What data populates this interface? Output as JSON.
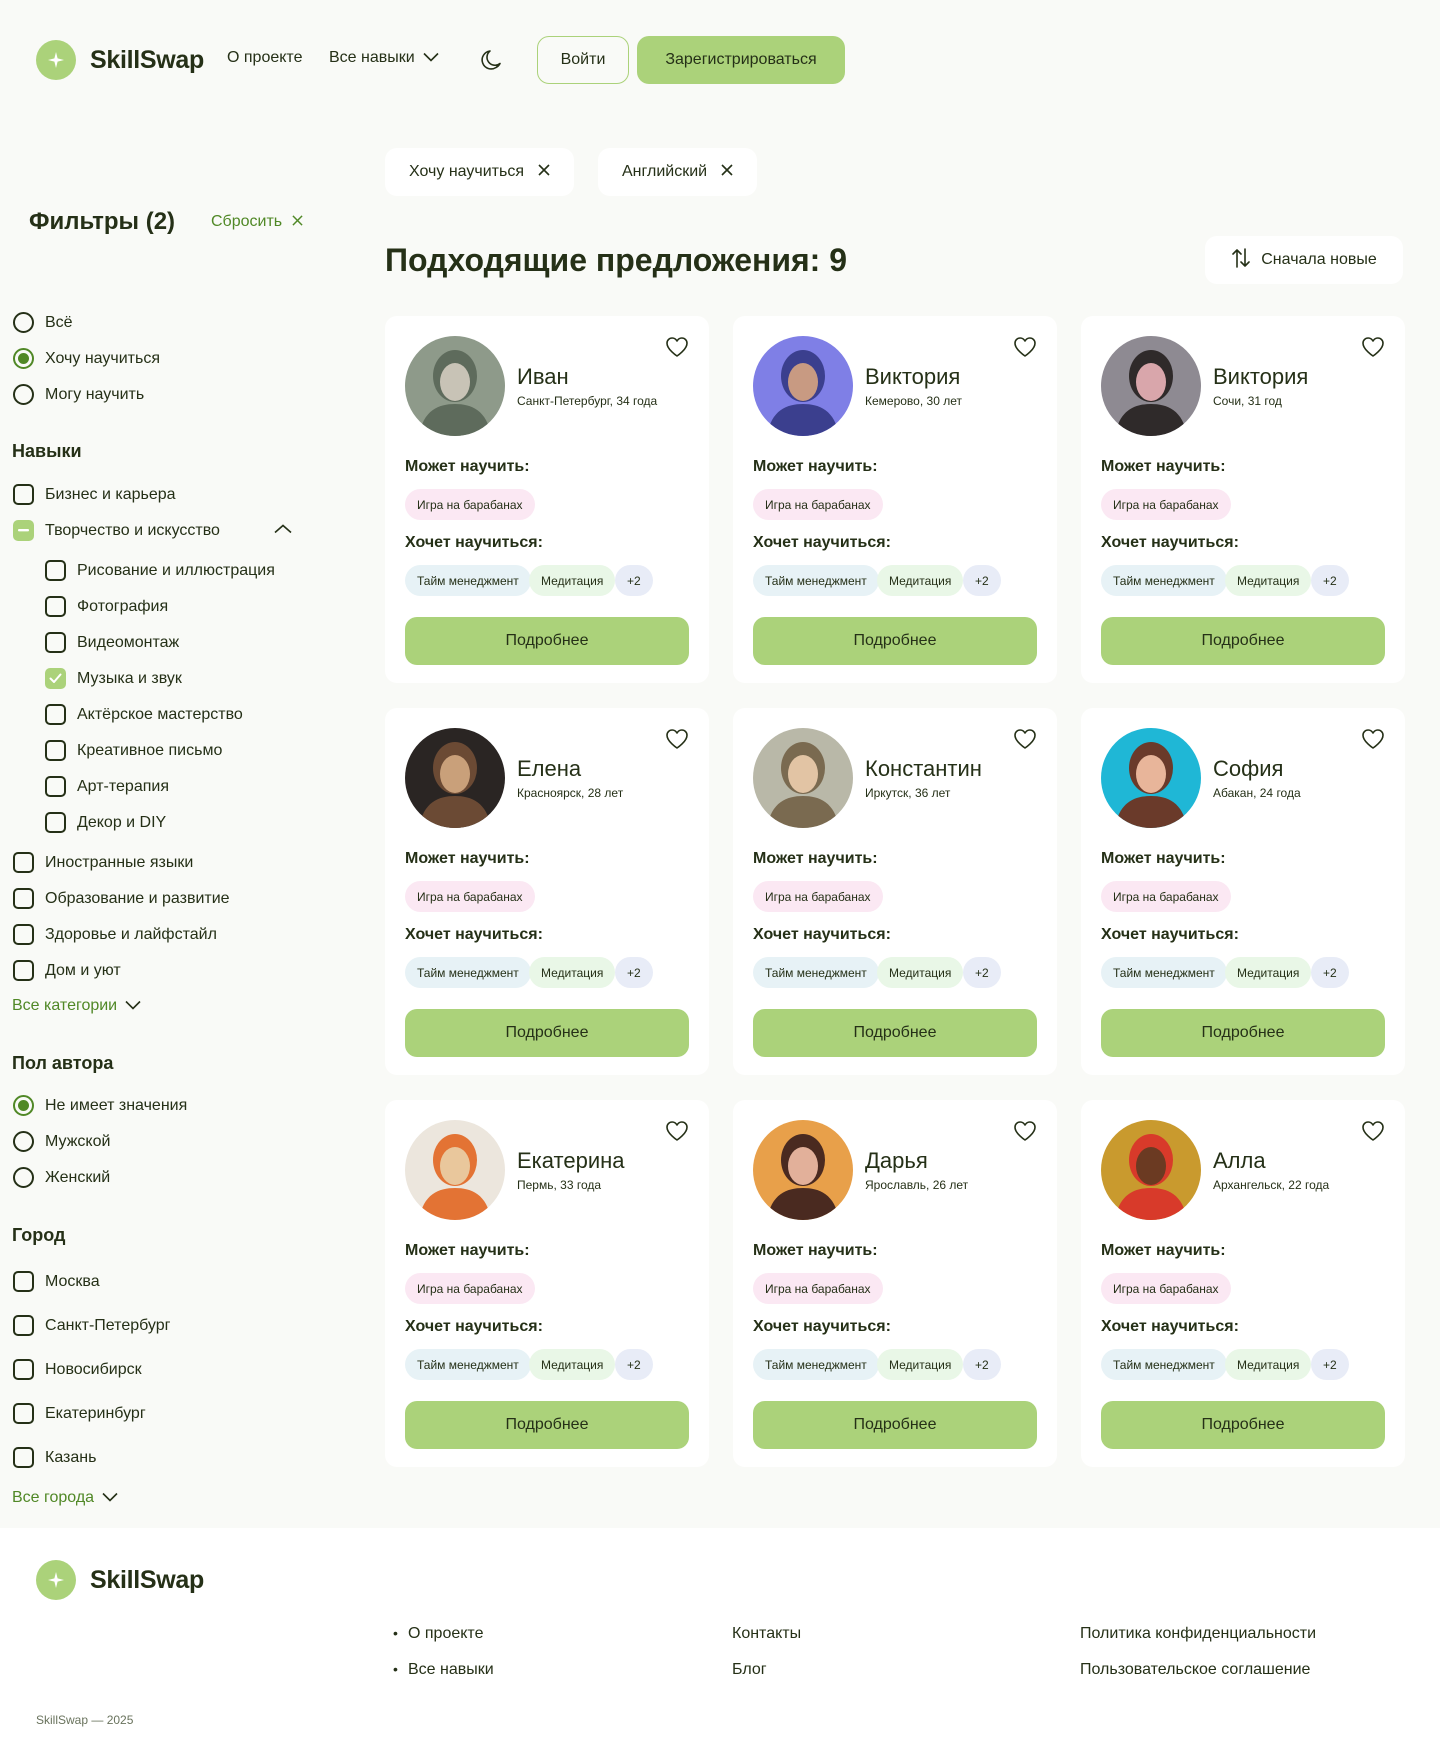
{
  "header": {
    "logo_text": "SkillSwap",
    "nav_about": "О проекте",
    "nav_skills": "Все навыки",
    "login": "Войти",
    "register": "Зарегистрироваться"
  },
  "active_filters": [
    "Хочу научиться",
    "Английский"
  ],
  "sidebar": {
    "title": "Фильтры (2)",
    "reset": "Сбросить",
    "mode_options": [
      {
        "label": "Всё",
        "checked": false
      },
      {
        "label": "Хочу научиться",
        "checked": true
      },
      {
        "label": "Могу научить",
        "checked": false
      }
    ],
    "skills_heading": "Навыки",
    "skills_top": [
      {
        "label": "Бизнес и карьера",
        "checked": false
      },
      {
        "label": "Творчество и искусство",
        "partial": true
      }
    ],
    "skills_sub": [
      {
        "label": "Рисование и иллюстрация",
        "checked": false
      },
      {
        "label": "Фотография",
        "checked": false
      },
      {
        "label": "Видеомонтаж",
        "checked": false
      },
      {
        "label": "Музыка и звук",
        "checked": true
      },
      {
        "label": "Актёрское мастерство",
        "checked": false
      },
      {
        "label": "Креативное письмо",
        "checked": false
      },
      {
        "label": "Арт-терапия",
        "checked": false
      },
      {
        "label": "Декор и DIY",
        "checked": false
      }
    ],
    "skills_bottom": [
      {
        "label": "Иностранные языки",
        "checked": false
      },
      {
        "label": "Образование и развитие",
        "checked": false
      },
      {
        "label": "Здоровье и лайфстайл",
        "checked": false
      },
      {
        "label": "Дом и уют",
        "checked": false
      }
    ],
    "all_categories": "Все категории",
    "gender_heading": "Пол автора",
    "gender_options": [
      {
        "label": "Не имеет значения",
        "checked": true
      },
      {
        "label": "Мужской",
        "checked": false
      },
      {
        "label": "Женский",
        "checked": false
      }
    ],
    "city_heading": "Город",
    "cities": [
      {
        "label": "Москва",
        "checked": false
      },
      {
        "label": "Санкт-Петербург",
        "checked": false
      },
      {
        "label": "Новосибирск",
        "checked": false
      },
      {
        "label": "Екатеринбург",
        "checked": false
      },
      {
        "label": "Казань",
        "checked": false
      }
    ],
    "all_cities": "Все города"
  },
  "results": {
    "title": "Подходящие предложения: 9",
    "sort": "Сначала новые"
  },
  "card_labels": {
    "can_teach": "Может научить:",
    "wants_learn": "Хочет научиться:",
    "details": "Подробнее"
  },
  "cards": [
    {
      "name": "Иван",
      "meta": "Санкт-Петербург, 34 года",
      "teach": "Игра на барабанах",
      "learn": [
        "Тайм менеджмент",
        "Медитация"
      ],
      "more": "+2",
      "avatar_colors": [
        "#8e9a8a",
        "#5e6b5c",
        "#c8c3b6"
      ]
    },
    {
      "name": "Виктория",
      "meta": "Кемерово, 30 лет",
      "teach": "Игра на барабанах",
      "learn": [
        "Тайм менеджмент",
        "Медитация"
      ],
      "more": "+2",
      "avatar_colors": [
        "#7f7fe6",
        "#3b3f8e",
        "#c89a82"
      ]
    },
    {
      "name": "Виктория",
      "meta": "Сочи, 31 год",
      "teach": "Игра на барабанах",
      "learn": [
        "Тайм менеджмент",
        "Медитация"
      ],
      "more": "+2",
      "avatar_colors": [
        "#8e8a92",
        "#2f2a2a",
        "#d9a6ab"
      ]
    },
    {
      "name": "Елена",
      "meta": "Красноярск, 28 лет",
      "teach": "Игра на барабанах",
      "learn": [
        "Тайм менеджмент",
        "Медитация"
      ],
      "more": "+2",
      "avatar_colors": [
        "#2a2523",
        "#6b4a34",
        "#c9a07a"
      ]
    },
    {
      "name": "Константин",
      "meta": "Иркутск, 36 лет",
      "teach": "Игра на барабанах",
      "learn": [
        "Тайм менеджмент",
        "Медитация"
      ],
      "more": "+2",
      "avatar_colors": [
        "#b9b8a8",
        "#7a6a50",
        "#e2c4a4"
      ]
    },
    {
      "name": "София",
      "meta": "Абакан, 24 года",
      "teach": "Игра на барабанах",
      "learn": [
        "Тайм менеджмент",
        "Медитация"
      ],
      "more": "+2",
      "avatar_colors": [
        "#1fb7d6",
        "#6a3a2a",
        "#e8b59a"
      ]
    },
    {
      "name": "Екатерина",
      "meta": "Пермь, 33 года",
      "teach": "Игра на барабанах",
      "learn": [
        "Тайм менеджмент",
        "Медитация"
      ],
      "more": "+2",
      "avatar_colors": [
        "#ece6dd",
        "#e37334",
        "#e9c79c"
      ]
    },
    {
      "name": "Дарья",
      "meta": "Ярославль, 26 лет",
      "teach": "Игра на барабанах",
      "learn": [
        "Тайм менеджмент",
        "Медитация"
      ],
      "more": "+2",
      "avatar_colors": [
        "#e8a04a",
        "#4a2a20",
        "#e2b09a"
      ]
    },
    {
      "name": "Алла",
      "meta": "Архангельск, 22 года",
      "teach": "Игра на барабанах",
      "learn": [
        "Тайм менеджмент",
        "Медитация"
      ],
      "more": "+2",
      "avatar_colors": [
        "#c99a2e",
        "#d83a2a",
        "#6b3a22"
      ]
    }
  ],
  "footer": {
    "logo_text": "SkillSwap",
    "col1": [
      "О проекте",
      "Все навыки"
    ],
    "col2": [
      "Контакты",
      "Блог"
    ],
    "col3": [
      "Политика конфиденциальности",
      "Пользовательское соглашение"
    ],
    "copyright": "SkillSwap — 2025"
  }
}
